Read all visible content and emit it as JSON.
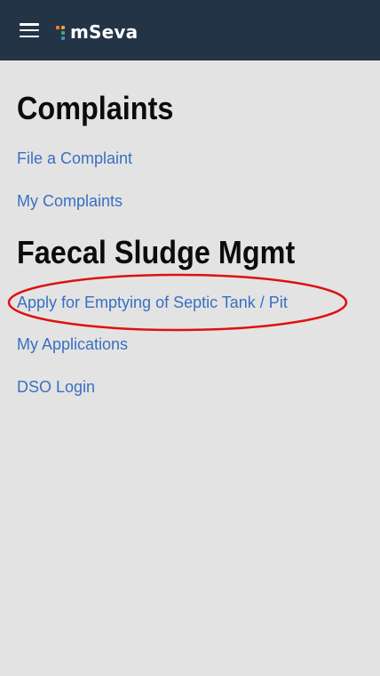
{
  "header": {
    "brand": "mSeva",
    "menu_icon": "hamburger-menu-icon",
    "logo_icon": "mseva-logo-icon",
    "background": "#243447"
  },
  "sections": [
    {
      "title": "Complaints",
      "links": [
        "File a Complaint",
        "My Complaints"
      ]
    },
    {
      "title": "Faecal Sludge Mgmt",
      "links": [
        "Apply for Emptying of Septic Tank / Pit",
        "My Applications",
        "DSO Login"
      ]
    }
  ],
  "colors": {
    "link": "#3a6fc4",
    "heading": "#0b0c0c",
    "page_bg": "#e3e3e3",
    "annotation": "#e01010"
  }
}
